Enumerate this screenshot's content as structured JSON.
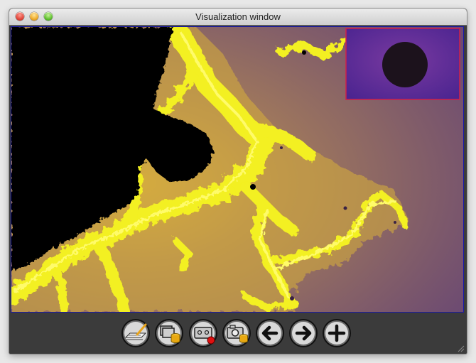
{
  "window": {
    "title": "Visualization window"
  },
  "toolbar": {
    "buttons": [
      {
        "name": "render-options",
        "icon": "hand-drawing-icon"
      },
      {
        "name": "save-image-layers",
        "icon": "layers-database-icon"
      },
      {
        "name": "record",
        "icon": "tape-record-icon"
      },
      {
        "name": "snapshot",
        "icon": "camera-database-icon"
      },
      {
        "name": "back",
        "icon": "arrow-left-icon"
      },
      {
        "name": "forward",
        "icon": "arrow-right-icon"
      },
      {
        "name": "zoom-in",
        "icon": "plus-icon"
      }
    ]
  },
  "colors": {
    "set_interior": "#000000",
    "fractal_edge": "#f3f020",
    "background_near": "#b48c55",
    "background_far": "#6c4a72",
    "thumbnail_bg": "#5a2a8c",
    "thumbnail_border": "#d0204a",
    "viewport_border": "#1a1aa8"
  }
}
